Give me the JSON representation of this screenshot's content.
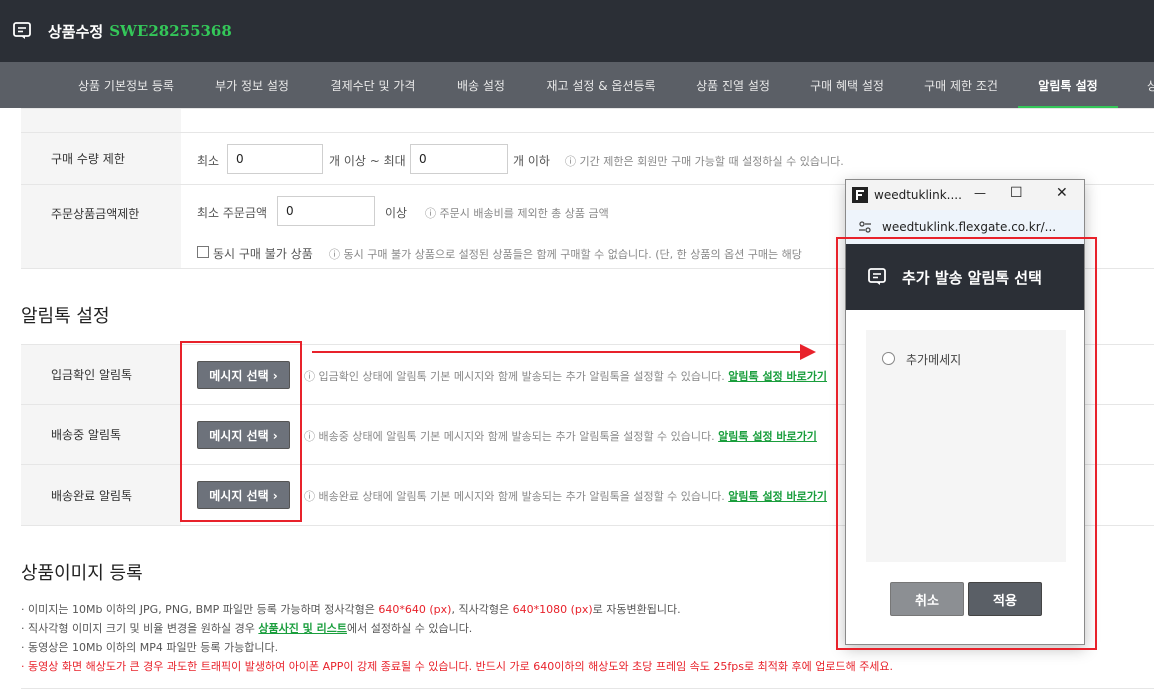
{
  "header": {
    "title": "상품수정",
    "product_code": "SWE28255368",
    "icon": "message-icon"
  },
  "tabs": [
    {
      "label": "상품 기본정보 등록"
    },
    {
      "label": "부가 정보 설정"
    },
    {
      "label": "결제수단 및 가격"
    },
    {
      "label": "배송 설정"
    },
    {
      "label": "재고 설정 & 옵션등록"
    },
    {
      "label": "상품 진열 설정"
    },
    {
      "label": "구매 혜택 설정"
    },
    {
      "label": "구매 제한 조건"
    },
    {
      "label": "알림톡 설정",
      "active": true
    },
    {
      "label": "상품"
    }
  ],
  "purchase_limit": {
    "label": "구매 수량 제한",
    "min_label": "최소",
    "min_value": "0",
    "mid_text": "개 이상 ~ 최대",
    "max_value": "0",
    "suffix": "개 이하",
    "hint": "ⓘ 기간 제한은 회원만 구매 가능할 때 설정하실 수 있습니다."
  },
  "order_amount_limit": {
    "label": "주문상품금액제한",
    "min_label": "최소 주문금액",
    "value": "0",
    "suffix": "이상",
    "hint": "ⓘ 주문시 배송비를 제외한 총 상품 금액",
    "checkbox_label": "동시 구매 불가 상품",
    "checkbox_checked": false,
    "checkbox_hint": "ⓘ 동시 구매 불가 상품으로 설정된 상품들은 함께 구매할 수 없습니다. (단, 한 상품의 옵션 구매는 해당"
  },
  "alimtalk": {
    "section_title": "알림톡 설정",
    "rows": [
      {
        "label": "입금확인 알림톡",
        "button": "메시지 선택 ›",
        "hint": "ⓘ 입금확인 상태에 알림톡 기본 메시지와 함께 발송되는 추가 알림톡을 설정할 수 있습니다.",
        "link": "알림톡 설정 바로가기"
      },
      {
        "label": "배송중 알림톡",
        "button": "메시지 선택 ›",
        "hint": "ⓘ 배송중 상태에 알림톡 기본 메시지와 함께 발송되는 추가 알림톡을 설정할 수 있습니다.",
        "link": "알림톡 설정 바로가기"
      },
      {
        "label": "배송완료 알림톡",
        "button": "메시지 선택 ›",
        "hint": "ⓘ 배송완료 상태에 알림톡 기본 메시지와 함께 발송되는 추가 알림톡을 설정할 수 있습니다.",
        "link": "알림톡 설정 바로가기"
      }
    ]
  },
  "images": {
    "section_title": "상품이미지 등록",
    "note1_a": "· 이미지는 10Mb 이하의 JPG, PNG, BMP 파일만 등록 가능하며 정사각형은 ",
    "note1_b": "640*640 (px)",
    "note1_c": ", 직사각형은 ",
    "note1_d": "640*1080 (px)",
    "note1_e": "로 자동변환됩니다.",
    "note2_a": "· 직사각형 이미지 크기 및 비율 변경을 원하실 경우 ",
    "note2_link": "상품사진 및 리스트",
    "note2_b": "에서 설정하실 수 있습니다.",
    "note3": "· 동영상은 10Mb 이하의 MP4 파일만 등록 가능합니다.",
    "note4": "· 동영상 화면 해상도가 큰 경우 과도한 트래픽이 발생하여 아이폰 APP이 강제 종료될 수 있습니다. 반드시 가로 640이하의 해상도와 초당 프레임 속도 25fps로 최적화 후에 업로드해 주세요."
  },
  "popup": {
    "window_title": "weedtuklink....",
    "url": "weedtuklink.flexgate.co.kr/...",
    "header": "추가 발송 알림톡 선택",
    "options": [
      {
        "label": "추가메세지",
        "selected": false
      }
    ],
    "cancel": "취소",
    "apply": "적용",
    "min_glyph": "—",
    "max_glyph": "☐",
    "close_glyph": "✕"
  },
  "colors": {
    "accent_green": "#34c759",
    "header_dark": "#2b2f36",
    "highlight_red": "#e8222b"
  }
}
